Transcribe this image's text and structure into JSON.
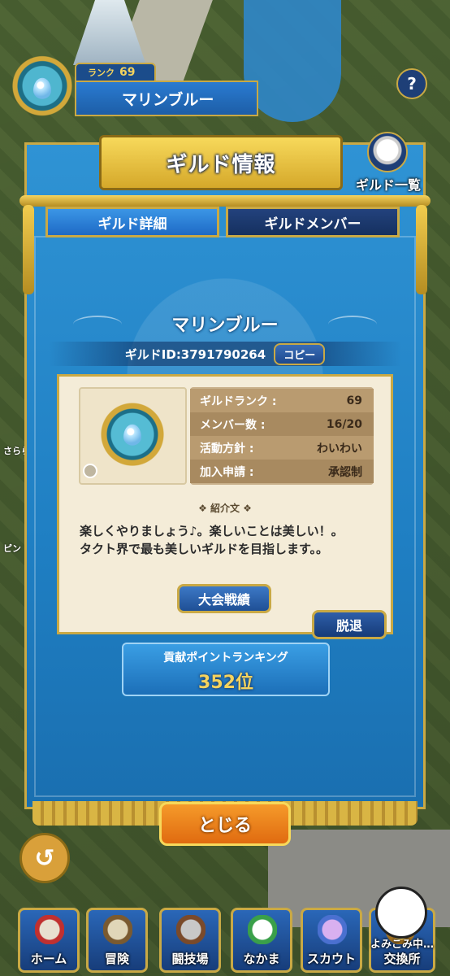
{
  "player": {
    "rank_label": "ランク",
    "rank_value": "69",
    "guild_name": "マリンブルー"
  },
  "help_label": "?",
  "dialog": {
    "title": "ギルド情報",
    "guild_list_label": "ギルド一覧",
    "tabs": [
      {
        "label": "ギルド詳細",
        "active": true
      },
      {
        "label": "ギルドメンバー",
        "active": false
      }
    ],
    "guild_name": "マリンブルー",
    "guild_id": "ギルドID:3791790264",
    "copy_label": "コピー",
    "stats": [
      {
        "label": "ギルドランク :",
        "value": "69"
      },
      {
        "label": "メンバー数 :",
        "value": "16/20"
      },
      {
        "label": "活動方針 :",
        "value": "わいわい"
      },
      {
        "label": "加入申請 :",
        "value": "承認制"
      }
    ],
    "intro_heading": "❖ 紹介文 ❖",
    "intro_lines": [
      "楽しくやりましょう♪。楽しいことは美しい！。",
      "タクト界で最も美しいギルドを目指します。。"
    ],
    "tournament_label": "大会戦績",
    "leave_label": "脱退",
    "ranking_label": "貢献ポイントランキング",
    "ranking_value": "352位",
    "close_label": "とじる"
  },
  "nav": [
    {
      "label": "ホーム",
      "icon": "tent-icon"
    },
    {
      "label": "冒険",
      "icon": "wagon-icon"
    },
    {
      "label": "闘技場",
      "icon": "arena-icon"
    },
    {
      "label": "なかま",
      "icon": "monster-icon"
    },
    {
      "label": "スカウト",
      "icon": "crystal-icon"
    },
    {
      "label": "交換所",
      "icon": "exchange-icon"
    }
  ],
  "loading_label": "よみこみ中…",
  "side_labels": [
    "さらら",
    "ピン"
  ],
  "colors": {
    "gold": "#c9a945",
    "banner_blue": "#1f7fc3",
    "close_orange": "#f08a1e",
    "rank_gold": "#f4d35e"
  }
}
